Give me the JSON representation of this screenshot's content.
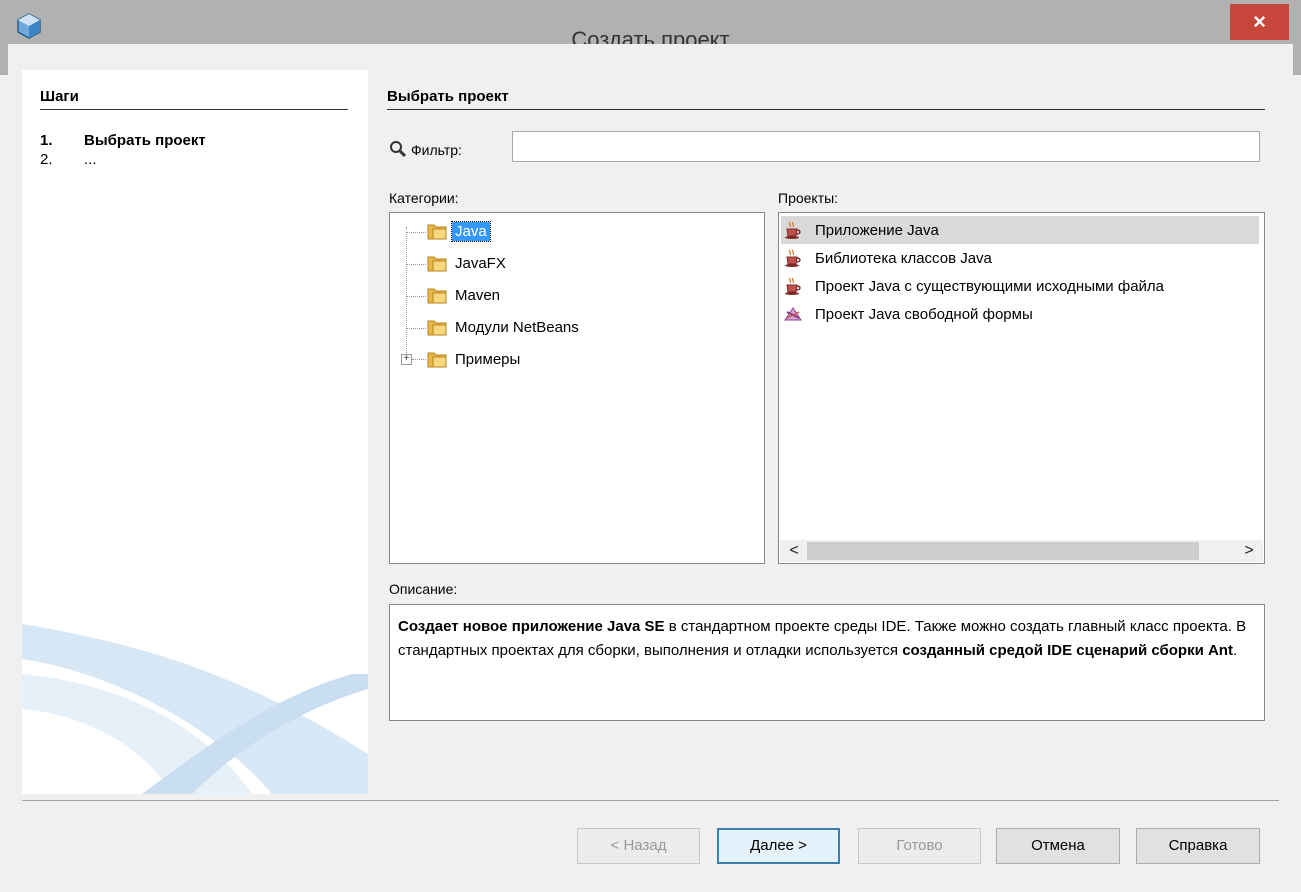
{
  "window": {
    "title": "Создать проект",
    "close_glyph": "×"
  },
  "steps": {
    "header": "Шаги",
    "items": [
      {
        "num": "1.",
        "label": "Выбрать проект"
      },
      {
        "num": "2.",
        "label": "..."
      }
    ]
  },
  "content": {
    "header": "Выбрать проект",
    "filter": {
      "label": "Фильтр:",
      "value": ""
    },
    "categories": {
      "label": "Категории:",
      "items": [
        "Java",
        "JavaFX",
        "Maven",
        "Модули NetBeans",
        "Примеры"
      ],
      "selected": "Java"
    },
    "projects": {
      "label": "Проекты:",
      "items": [
        "Приложение Java",
        "Библиотека классов Java",
        "Проект Java с существующими исходными файла",
        "Проект Java свободной формы"
      ],
      "selected": "Приложение Java"
    },
    "description": {
      "label": "Описание:",
      "bold1": "Создает новое приложение Java SE",
      "text1": " в стандартном проекте среды IDE. Также можно создать главный класс проекта. В стандартных проектах для сборки, выполнения и отладки используется ",
      "bold2": "созданный средой IDE сценарий сборки Ant",
      "text2": "."
    }
  },
  "buttons": {
    "back": "< Назад",
    "next": "Далее >",
    "finish": "Готово",
    "cancel": "Отмена",
    "help": "Справка"
  },
  "scrollbar": {
    "left_arrow": "<",
    "right_arrow": ">"
  },
  "icons": {
    "app": "netbeans-cube-icon",
    "filter": "magnifier-icon",
    "folder": "folder-icon",
    "java_project": "java-cup-icon",
    "freeform_project": "freeform-project-icon"
  },
  "colors": {
    "close_button": "#c7463b",
    "title_bar": "#b1b1b1",
    "selection": "#3399ff",
    "default_button_border": "#3c7fb1"
  }
}
